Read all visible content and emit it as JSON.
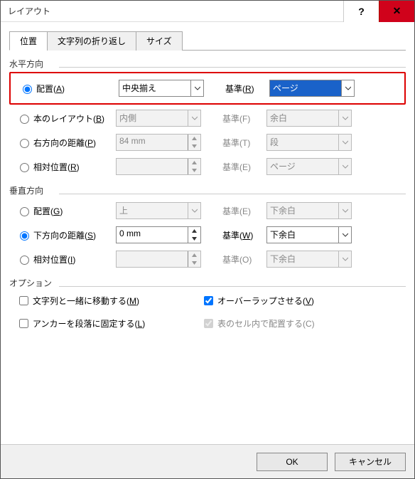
{
  "window": {
    "title": "レイアウト"
  },
  "tabs": {
    "position": "位置",
    "wrap": "文字列の折り返し",
    "size": "サイズ"
  },
  "horizontal": {
    "title": "水平方向",
    "alignment": {
      "label_pre": "配置(",
      "key": "A",
      "label_post": ")",
      "value": "中央揃え",
      "ref_pre": "基準(",
      "ref_key": "R",
      "ref_post": ")",
      "ref_value": "ページ"
    },
    "book": {
      "label_pre": "本のレイアウト(",
      "key": "B",
      "label_post": ")",
      "value": "内側",
      "ref": "基準(F)",
      "ref_value": "余白"
    },
    "absolute": {
      "label_pre": "右方向の距離(",
      "key": "P",
      "label_post": ")",
      "value": "84 mm",
      "ref": "基準(T)",
      "ref_value": "段"
    },
    "relative": {
      "label_pre": "相対位置(",
      "key": "R",
      "label_post": ")",
      "value": "",
      "ref": "基準(E)",
      "ref_value": "ページ"
    }
  },
  "vertical": {
    "title": "垂直方向",
    "alignment": {
      "label_pre": "配置(",
      "key": "G",
      "label_post": ")",
      "value": "上",
      "ref": "基準(E)",
      "ref_value": "下余白"
    },
    "absolute": {
      "label_pre": "下方向の距離(",
      "key": "S",
      "label_post": ")",
      "value": "0 mm",
      "ref_pre": "基準(",
      "ref_key": "W",
      "ref_post": ")",
      "ref_value": "下余白"
    },
    "relative": {
      "label_pre": "相対位置(",
      "key": "I",
      "label_post": ")",
      "value": "",
      "ref": "基準(O)",
      "ref_value": "下余白"
    }
  },
  "options": {
    "title": "オプション",
    "move_pre": "文字列と一緒に移動する(",
    "move_key": "M",
    "move_post": ")",
    "anchor_pre": "アンカーを段落に固定する(",
    "anchor_key": "L",
    "anchor_post": ")",
    "overlap_pre": "オーバーラップさせる(",
    "overlap_key": "V",
    "overlap_post": ")",
    "cell": "表のセル内で配置する(C)"
  },
  "footer": {
    "ok": "OK",
    "cancel": "キャンセル"
  }
}
